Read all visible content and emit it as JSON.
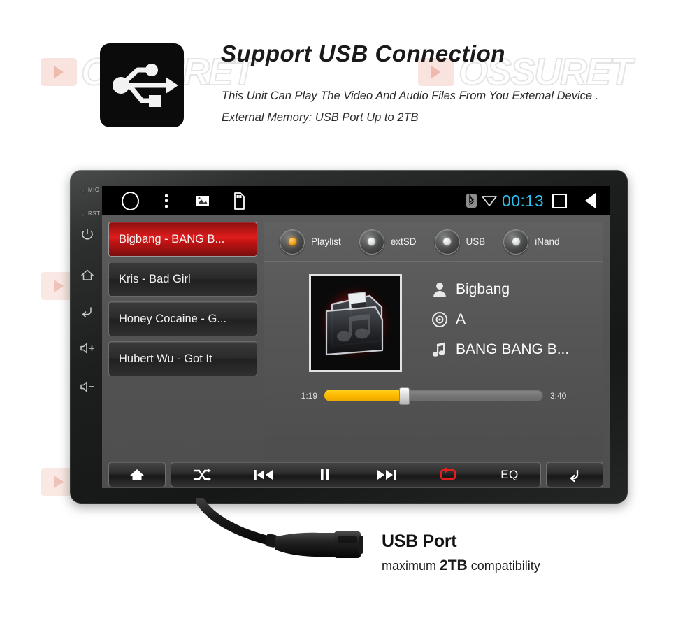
{
  "header": {
    "title": "Support USB Connection",
    "line1": "This Unit Can Play The Video And Audio Files From You Extemal Device .",
    "line2": "External Memory: USB Port Up to 2TB",
    "badge_icon": "usb-icon"
  },
  "watermark": {
    "text": "OSSURET"
  },
  "device": {
    "side_controls": [
      {
        "name": "mic",
        "label": "MIC",
        "type": "dot-label"
      },
      {
        "name": "reset",
        "label": "RST",
        "type": "dot-label"
      },
      {
        "name": "power",
        "label": "",
        "icon": "power-icon"
      },
      {
        "name": "home",
        "label": "",
        "icon": "home-icon"
      },
      {
        "name": "back",
        "label": "",
        "icon": "back-arrow-icon"
      },
      {
        "name": "volume-up",
        "label": "+",
        "icon": "volume-up-icon"
      },
      {
        "name": "volume-down",
        "label": "−",
        "icon": "volume-down-icon"
      }
    ],
    "statusbar": {
      "left_icons": [
        "home-circle-icon",
        "overflow-menu-icon",
        "gallery-icon",
        "sd-card-icon"
      ],
      "bluetooth_icon": "bluetooth-icon",
      "wifi_icon": "wifi-icon",
      "clock": "00:13",
      "clock_color": "#2fc0f0",
      "recents_icon": "recents-square-icon",
      "back_icon": "back-triangle-icon"
    },
    "playlist": {
      "tracks": [
        {
          "label": "Bigbang - BANG B...",
          "selected": true
        },
        {
          "label": "Kris - Bad Girl",
          "selected": false
        },
        {
          "label": "Honey Cocaine - G...",
          "selected": false
        },
        {
          "label": "Hubert Wu - Got It",
          "selected": false
        }
      ],
      "selected_color": "#e01c1c"
    },
    "sources": [
      {
        "label": "Playlist",
        "active": true
      },
      {
        "label": "extSD",
        "active": false
      },
      {
        "label": "USB",
        "active": false
      },
      {
        "label": "iNand",
        "active": false
      }
    ],
    "source_active_color": "#f5a310",
    "now_playing": {
      "album_art": "music-folder-icon",
      "artist": "Bigbang",
      "album": "A",
      "title": "BANG BANG B...",
      "artist_icon": "person-icon",
      "album_icon": "disc-icon",
      "title_icon": "music-note-icon",
      "elapsed": "1:19",
      "duration": "3:40",
      "progress_percent": 36,
      "progress_color": "#fdb700"
    },
    "transport": {
      "home_label": "home-icon",
      "shuffle_label": "shuffle-icon",
      "prev_label": "previous-icon",
      "pause_label": "pause-icon",
      "next_label": "next-icon",
      "repeat_label": "repeat-icon",
      "repeat_color": "#e02020",
      "eq_label": "EQ",
      "back_label": "back-icon"
    }
  },
  "caption": {
    "title": "USB Port",
    "sub_pre": "maximum ",
    "sub_em": "2TB",
    "sub_post": " compatibility"
  }
}
